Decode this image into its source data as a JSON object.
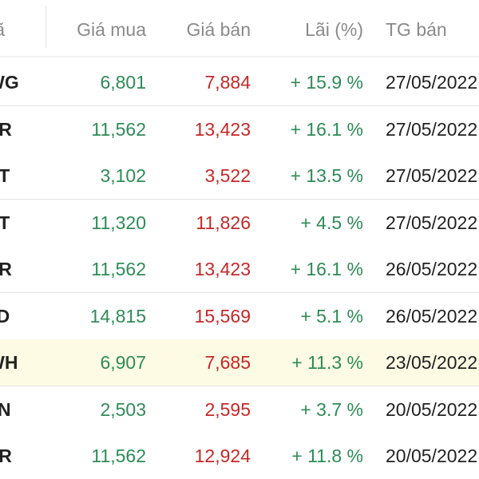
{
  "header": {
    "symbol": "Mã",
    "buy_price": "Giá mua",
    "sell_price": "Giá bán",
    "profit": "Lãi (%)",
    "sell_time": "TG bán"
  },
  "rows": [
    {
      "symbol": "MWG",
      "buy": "6,801",
      "sell": "7,884",
      "profit": "+ 15.9 %",
      "date": "27/05/2022",
      "highlight": false
    },
    {
      "symbol": "HCR",
      "buy": "11,562",
      "sell": "13,423",
      "profit": "+ 16.1 %",
      "date": "27/05/2022",
      "highlight": false
    },
    {
      "symbol": "HHT",
      "buy": "3,102",
      "sell": "3,522",
      "profit": "+ 13.5 %",
      "date": "27/05/2022",
      "highlight": false
    },
    {
      "symbol": "ANT",
      "buy": "11,320",
      "sell": "11,826",
      "profit": "+ 4.5 %",
      "date": "27/05/2022",
      "highlight": false
    },
    {
      "symbol": "HCR",
      "buy": "11,562",
      "sell": "13,423",
      "profit": "+ 16.1 %",
      "date": "26/05/2022",
      "highlight": false
    },
    {
      "symbol": "HTD",
      "buy": "14,815",
      "sell": "15,569",
      "profit": "+ 5.1 %",
      "date": "26/05/2022",
      "highlight": false
    },
    {
      "symbol": "MWH",
      "buy": "6,907",
      "sell": "7,685",
      "profit": "+ 11.3 %",
      "date": "23/05/2022",
      "highlight": true
    },
    {
      "symbol": "HVN",
      "buy": "2,503",
      "sell": "2,595",
      "profit": "+ 3.7 %",
      "date": "20/05/2022",
      "highlight": false
    },
    {
      "symbol": "HCR",
      "buy": "11,562",
      "sell": "12,924",
      "profit": "+ 11.8 %",
      "date": "20/05/2022",
      "highlight": false
    }
  ],
  "colors": {
    "buy": "#2e8b57",
    "sell": "#c62828",
    "profit": "#2e8b57",
    "highlight_row": "#fdfbe4"
  }
}
